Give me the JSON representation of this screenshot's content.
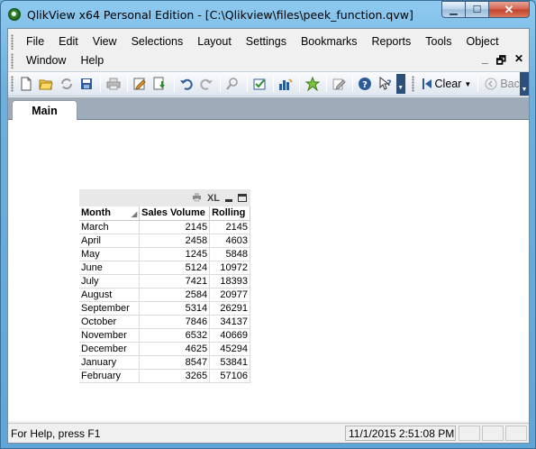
{
  "window": {
    "title": "QlikView x64 Personal Edition - [C:\\Qlikview\\files\\peek_function.qvw]",
    "minimize_glyph": "▁",
    "maximize_glyph": "☐",
    "close_glyph": "✕"
  },
  "menu": {
    "row1": [
      "File",
      "Edit",
      "View",
      "Selections",
      "Layout",
      "Settings",
      "Bookmarks",
      "Reports",
      "Tools",
      "Object"
    ],
    "row2": [
      "Window",
      "Help"
    ],
    "mdi_minimize": "_",
    "mdi_restore": "🗗",
    "mdi_close": "✕"
  },
  "toolbar": {
    "icons": [
      "new-document",
      "open-folder",
      "reload",
      "save",
      "print",
      "edit-script",
      "reload-data",
      "undo",
      "redo",
      "search",
      "selections",
      "chart-properties",
      "bookmark-star",
      "edit",
      "help",
      "whats-this"
    ],
    "clear_label": "Clear",
    "back_label": "Back"
  },
  "sheet": {
    "tabs": [
      "Main"
    ]
  },
  "tablebox": {
    "caption_icons": [
      "print-icon",
      "xl-export",
      "minimize",
      "maximize"
    ],
    "xl_label": "XL",
    "headers": [
      "Month",
      "Sales Volume",
      "Rolling"
    ],
    "rows": [
      [
        "March",
        "2145",
        "2145"
      ],
      [
        "April",
        "2458",
        "4603"
      ],
      [
        "May",
        "1245",
        "5848"
      ],
      [
        "June",
        "5124",
        "10972"
      ],
      [
        "July",
        "7421",
        "18393"
      ],
      [
        "August",
        "2584",
        "20977"
      ],
      [
        "September",
        "5314",
        "26291"
      ],
      [
        "October",
        "7846",
        "34137"
      ],
      [
        "November",
        "6532",
        "40669"
      ],
      [
        "December",
        "4625",
        "45294"
      ],
      [
        "January",
        "8547",
        "53841"
      ],
      [
        "February",
        "3265",
        "57106"
      ]
    ]
  },
  "statusbar": {
    "help_text": "For Help, press F1",
    "datetime": "11/1/2015 2:51:08 PM"
  }
}
